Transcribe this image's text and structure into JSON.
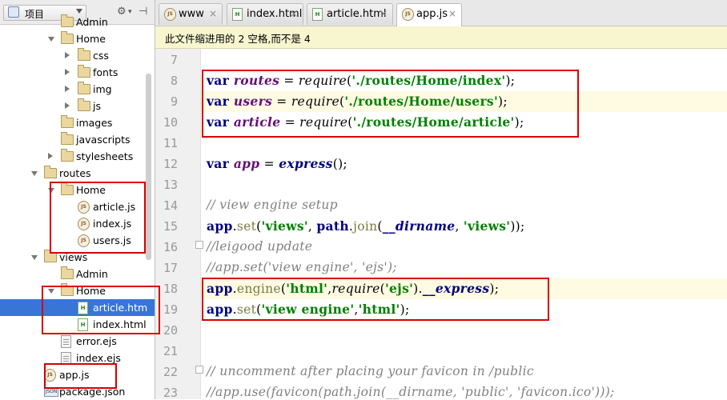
{
  "project": {
    "title": "项目",
    "tree": [
      {
        "label": "Admin",
        "type": "folder",
        "indent": 2,
        "arrow": "none"
      },
      {
        "label": "Home",
        "type": "folder",
        "indent": 2,
        "arrow": "open"
      },
      {
        "label": "css",
        "type": "folder",
        "indent": 3,
        "arrow": "closed"
      },
      {
        "label": "fonts",
        "type": "folder",
        "indent": 3,
        "arrow": "closed"
      },
      {
        "label": "img",
        "type": "folder",
        "indent": 3,
        "arrow": "closed"
      },
      {
        "label": "js",
        "type": "folder",
        "indent": 3,
        "arrow": "closed"
      },
      {
        "label": "images",
        "type": "folder",
        "indent": 2,
        "arrow": "none"
      },
      {
        "label": "javascripts",
        "type": "folder",
        "indent": 2,
        "arrow": "none"
      },
      {
        "label": "stylesheets",
        "type": "folder",
        "indent": 2,
        "arrow": "closed"
      },
      {
        "label": "routes",
        "type": "folder",
        "indent": 1,
        "arrow": "open"
      },
      {
        "label": "Home",
        "type": "folder",
        "indent": 2,
        "arrow": "open"
      },
      {
        "label": "article.js",
        "type": "js",
        "indent": 3,
        "arrow": "none"
      },
      {
        "label": "index.js",
        "type": "js",
        "indent": 3,
        "arrow": "none"
      },
      {
        "label": "users.js",
        "type": "js",
        "indent": 3,
        "arrow": "none"
      },
      {
        "label": "views",
        "type": "folder",
        "indent": 1,
        "arrow": "open"
      },
      {
        "label": "Admin",
        "type": "folder",
        "indent": 2,
        "arrow": "none"
      },
      {
        "label": "Home",
        "type": "folder",
        "indent": 2,
        "arrow": "open"
      },
      {
        "label": "article.htm",
        "type": "html",
        "indent": 3,
        "arrow": "none",
        "selected": true
      },
      {
        "label": "index.html",
        "type": "html",
        "indent": 3,
        "arrow": "none"
      },
      {
        "label": "error.ejs",
        "type": "ejs",
        "indent": 2,
        "arrow": "none"
      },
      {
        "label": "index.ejs",
        "type": "ejs",
        "indent": 2,
        "arrow": "none"
      },
      {
        "label": "app.js",
        "type": "js",
        "indent": 1,
        "arrow": "none"
      },
      {
        "label": "package.json",
        "type": "json",
        "indent": 1,
        "arrow": "none"
      }
    ]
  },
  "tabs": [
    {
      "label": "www",
      "icon": "js-icon",
      "active": false
    },
    {
      "label": "index.html",
      "icon": "html-icon",
      "active": false
    },
    {
      "label": "article.html",
      "icon": "html-icon",
      "active": false
    },
    {
      "label": "app.js",
      "icon": "js-icon",
      "active": true
    }
  ],
  "notice": "此文件缩进用的 2 空格,而不是 4",
  "editor": {
    "lines": [
      {
        "num": "7",
        "tokens": []
      },
      {
        "num": "8",
        "tokens": [
          [
            "kw",
            "var "
          ],
          [
            "vr",
            "routes"
          ],
          [
            "",
            " = "
          ],
          [
            "fn",
            "require"
          ],
          [
            "",
            "("
          ],
          [
            "str",
            "'./routes/Home/index'"
          ],
          [
            "",
            ");"
          ]
        ]
      },
      {
        "num": "9",
        "tokens": [
          [
            "kw",
            "var "
          ],
          [
            "vr",
            "users"
          ],
          [
            "",
            " = "
          ],
          [
            "fn",
            "require"
          ],
          [
            "",
            "("
          ],
          [
            "str",
            "'./routes/Home/users'"
          ],
          [
            "",
            ");"
          ]
        ]
      },
      {
        "num": "10",
        "tokens": [
          [
            "kw",
            "var "
          ],
          [
            "vr",
            "article"
          ],
          [
            "",
            " = "
          ],
          [
            "fn",
            "require"
          ],
          [
            "",
            "("
          ],
          [
            "str",
            "'./routes/Home/article'"
          ],
          [
            "",
            ");"
          ]
        ]
      },
      {
        "num": "11",
        "tokens": []
      },
      {
        "num": "12",
        "tokens": [
          [
            "kw",
            "var "
          ],
          [
            "vr",
            "app"
          ],
          [
            "",
            " = "
          ],
          [
            "spec",
            "express"
          ],
          [
            "",
            "();"
          ]
        ]
      },
      {
        "num": "13",
        "tokens": []
      },
      {
        "num": "14",
        "tokens": [
          [
            "cm",
            "// view engine setup"
          ]
        ]
      },
      {
        "num": "15",
        "tokens": [
          [
            "ob",
            "app"
          ],
          [
            "",
            "."
          ],
          [
            "me",
            "set"
          ],
          [
            "",
            "("
          ],
          [
            "str",
            "'views'"
          ],
          [
            "",
            ", "
          ],
          [
            "ob",
            "path"
          ],
          [
            "",
            "."
          ],
          [
            "me",
            "join"
          ],
          [
            "",
            "("
          ],
          [
            "spec",
            "__dirname"
          ],
          [
            "",
            ", "
          ],
          [
            "str",
            "'views'"
          ],
          [
            "",
            "));"
          ]
        ]
      },
      {
        "num": "16",
        "tokens": [
          [
            "cm",
            "//leigood update"
          ]
        ]
      },
      {
        "num": "17",
        "tokens": [
          [
            "cm",
            "//app.set('view engine', 'ejs');"
          ]
        ]
      },
      {
        "num": "18",
        "tokens": [
          [
            "ob",
            "app"
          ],
          [
            "",
            "."
          ],
          [
            "me",
            "engine"
          ],
          [
            "",
            "("
          ],
          [
            "str",
            "'html'"
          ],
          [
            "",
            ","
          ],
          [
            "fn",
            "require"
          ],
          [
            "",
            "("
          ],
          [
            "str",
            "'ejs'"
          ],
          [
            "",
            ")."
          ],
          [
            "spec",
            "__express"
          ],
          [
            "",
            ");"
          ]
        ]
      },
      {
        "num": "19",
        "tokens": [
          [
            "ob",
            "app"
          ],
          [
            "",
            "."
          ],
          [
            "me",
            "set"
          ],
          [
            "",
            "("
          ],
          [
            "str",
            "'view engine'"
          ],
          [
            "",
            ","
          ],
          [
            "str",
            "'html'"
          ],
          [
            "",
            ");"
          ]
        ]
      },
      {
        "num": "20",
        "tokens": []
      },
      {
        "num": "21",
        "tokens": []
      },
      {
        "num": "22",
        "tokens": [
          [
            "cm",
            "// uncomment after placing your favicon in /public"
          ]
        ]
      },
      {
        "num": "23",
        "tokens": [
          [
            "cm",
            "//app.use(favicon(path.join(__dirname, 'public', 'favicon.ico')));"
          ]
        ]
      }
    ]
  }
}
